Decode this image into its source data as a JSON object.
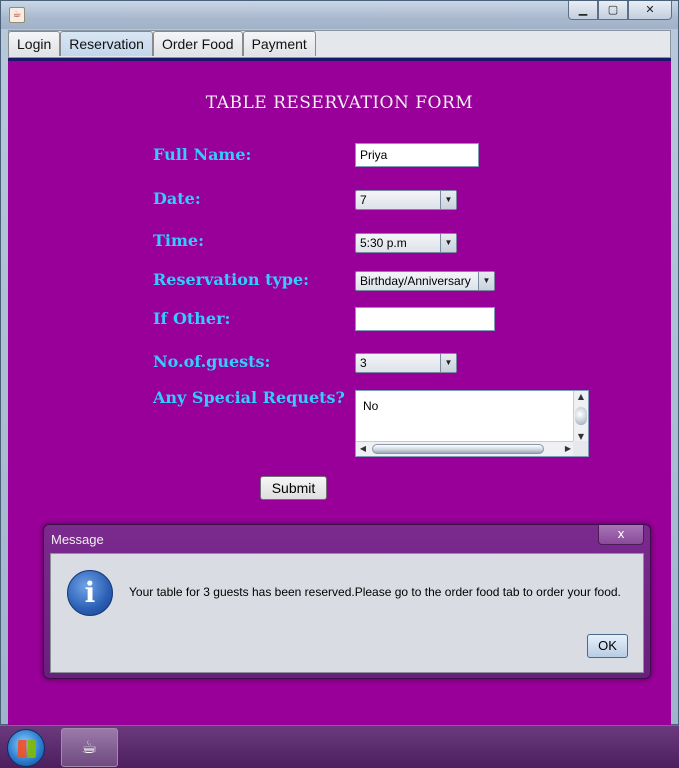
{
  "window": {
    "app_icon": "java-coffee-icon",
    "controls": {
      "minimize": "minimize-icon",
      "maximize": "maximize-icon",
      "close": "close-icon"
    }
  },
  "tabs": [
    {
      "label": "Login"
    },
    {
      "label": "Reservation"
    },
    {
      "label": "Order Food"
    },
    {
      "label": "Payment"
    }
  ],
  "active_tab": "Reservation",
  "form": {
    "title": "TABLE RESERVATION FORM",
    "full_name_label": "Full Name:",
    "full_name_value": "Priya",
    "date_label": "Date:",
    "date_value": "7",
    "time_label": "Time:",
    "time_value": "5:30 p.m",
    "reservation_type_label": "Reservation type:",
    "reservation_type_value": "Birthday/Anniversary",
    "if_other_label": "If Other:",
    "if_other_value": "",
    "guests_label": "No.of.guests:",
    "guests_value": "3",
    "special_label": "Any Special Requets?",
    "special_value": "No",
    "submit_label": "Submit"
  },
  "dialog": {
    "title": "Message",
    "close_glyph": "x",
    "icon": "info-icon",
    "message": "Your table for 3 guests has been reserved.Please go to the order food tab to order your food.",
    "ok_label": "OK"
  },
  "taskbar": {
    "start_icon": "windows-start-icon",
    "app_icon": "java-icon"
  },
  "colors": {
    "panel_bg": "#990099",
    "label_color": "#33ccff",
    "title_color": "#f2f2f2",
    "dialog_frame": "#7b2a8e"
  }
}
